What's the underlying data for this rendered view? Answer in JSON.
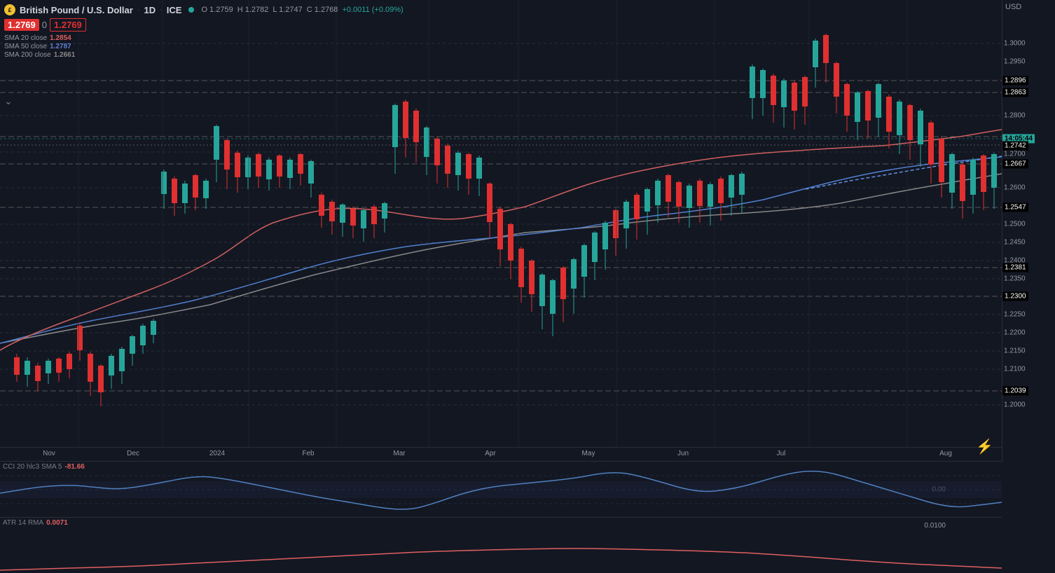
{
  "header": {
    "symbol": "British Pound / U.S. Dollar",
    "timeframe": "1D",
    "exchange": "ICE",
    "open": "O 1.2759",
    "high": "H 1.2782",
    "low": "L 1.2747",
    "close": "C 1.2768",
    "change": "+0.0011 (+0.09%)",
    "currency": "USD"
  },
  "price_input": {
    "price1": "1.2769",
    "qty": "0",
    "price2": "1.2769"
  },
  "sma": {
    "sma20_label": "SMA 20 close",
    "sma20_val": "1.2854",
    "sma50_label": "SMA 50 close",
    "sma50_val": "1.2787",
    "sma200_label": "SMA 200 close",
    "sma200_val": "1.2661"
  },
  "price_levels": {
    "p3000": "1.3000",
    "p2950": "1.2950",
    "p2896": "1.2896",
    "p2863": "1.2863",
    "p2800": "1.2800",
    "p2742": "1.2742",
    "p2700": "1.2700",
    "p2667": "1.2667",
    "p2600": "1.2600",
    "p2547": "1.2547",
    "p2500": "1.2500",
    "p2450": "1.2450",
    "p2400": "1.2400",
    "p2381": "1.2381",
    "p2350": "1.2350",
    "p2300": "1.2300",
    "p2250": "1.2250",
    "p2200": "1.2200",
    "p2150": "1.2150",
    "p2100": "1.2100",
    "p2039": "1.2039",
    "p2000": "1.2000",
    "current_time": "14:05:44",
    "current_price": "1.2769"
  },
  "x_axis_labels": [
    "Nov",
    "Dec",
    "2024",
    "Feb",
    "Mar",
    "Apr",
    "May",
    "Jun",
    "Jul",
    "Aug"
  ],
  "indicators": {
    "cci_label": "CCI 20 hlc3 SMA 5",
    "cci_val": "-81.66",
    "atr_label": "ATR 14 RMA",
    "atr_val": "0.0071",
    "zero_line": "0.00",
    "atr_zero": "0.0100"
  },
  "dashed_levels": [
    1.2896,
    1.2863,
    1.2742,
    1.2667,
    1.2547,
    1.2381,
    1.23,
    1.2039
  ],
  "dotted_levels": [
    1.275
  ]
}
